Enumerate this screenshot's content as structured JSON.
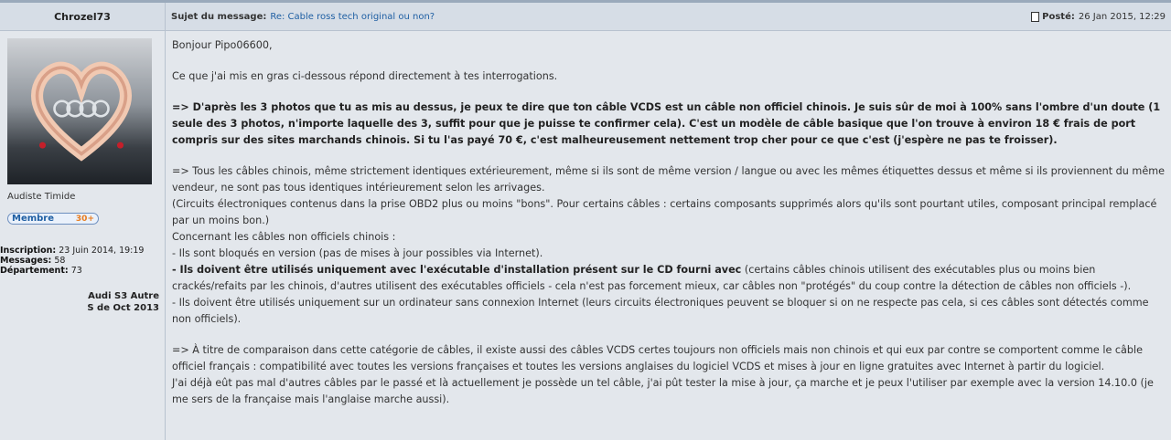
{
  "author": {
    "name": "Chrozel73",
    "rank": "Audiste Timide",
    "badge_label": "Membre",
    "badge_level": "30+",
    "inscription_label": "Inscription:",
    "inscription_value": "23 Juin 2014, 19:19",
    "messages_label": "Messages:",
    "messages_value": "58",
    "departement_label": "Département:",
    "departement_value": "73",
    "car_line1": "Audi S3 Autre",
    "car_line2": "S de Oct 2013"
  },
  "post": {
    "subject_label": "Sujet du message:",
    "subject": "Re: Cable ross tech original ou non?",
    "posted_label": "Posté:",
    "posted_date": "26 Jan 2015, 12:29",
    "greeting": "Bonjour Pipo06600,",
    "intro": "Ce que j'ai mis en gras ci-dessous répond directement à tes interrogations.",
    "para1": "=> D'après les 3 photos que tu as mis au dessus, je peux te dire que ton câble VCDS est un câble non officiel chinois. Je suis sûr de moi à 100% sans l'ombre d'un doute (1 seule des 3 photos, n'importe laquelle des 3, suffit pour que je puisse te confirmer cela). C'est un modèle de câble basique que l'on trouve à environ 18 € frais de port compris sur des sites marchands chinois. Si tu l'as payé 70 €, c'est malheureusement nettement trop cher pour ce que c'est (j'espère ne pas te froisser).",
    "para2_a": "=> Tous les câbles chinois, même strictement identiques extérieurement, même si ils sont de même version / langue ou avec les mêmes étiquettes dessus et même si ils proviennent du même vendeur, ne sont pas tous identiques intérieurement selon les arrivages.",
    "para2_b": "(Circuits électroniques contenus dans la prise OBD2 plus ou moins \"bons\". Pour certains câbles : certains composants supprimés alors qu'ils sont pourtant utiles, composant principal remplacé par un moins bon.)",
    "para2_c": "Concernant les câbles non officiels chinois :",
    "para2_d": "- Ils sont bloqués en version (pas de mises à jour possibles via Internet).",
    "para2_e_bold": "- Ils doivent être utilisés uniquement avec l'exécutable d'installation présent sur le CD fourni avec",
    "para2_e_rest": " (certains câbles chinois utilisent des exécutables plus ou moins bien crackés/refaits par les chinois, d'autres utilisent des exécutables officiels - cela n'est pas forcement mieux, car câbles non \"protégés\" du coup contre la détection de câbles non officiels -).",
    "para2_f": "- Ils doivent être utilisés uniquement sur un ordinateur sans connexion Internet (leurs circuits électroniques peuvent se bloquer si on ne respecte pas cela, si ces câbles sont détectés comme non officiels).",
    "para3_a": "=> À titre de comparaison dans cette catégorie de câbles, il existe aussi des câbles VCDS certes toujours non officiels mais non chinois et qui eux par contre se comportent comme le câble officiel français : compatibilité avec toutes les versions françaises et toutes les versions anglaises du logiciel VCDS et mises à jour en ligne gratuites avec Internet à partir du logiciel.",
    "para3_b": "J'ai déjà eût pas mal d'autres câbles par le passé et là actuellement je possède un tel câble, j'ai pût tester la mise à jour, ça marche et je peux l'utiliser par exemple avec la version 14.10.0 (je me sers de la française mais l'anglaise marche aussi)."
  },
  "icons": {
    "posted": "document-icon"
  },
  "colors": {
    "link": "#1f5fa3",
    "header_bg": "#d6dde6",
    "page_bg": "#e3e7ec",
    "badge_level": "#e87b1e"
  }
}
